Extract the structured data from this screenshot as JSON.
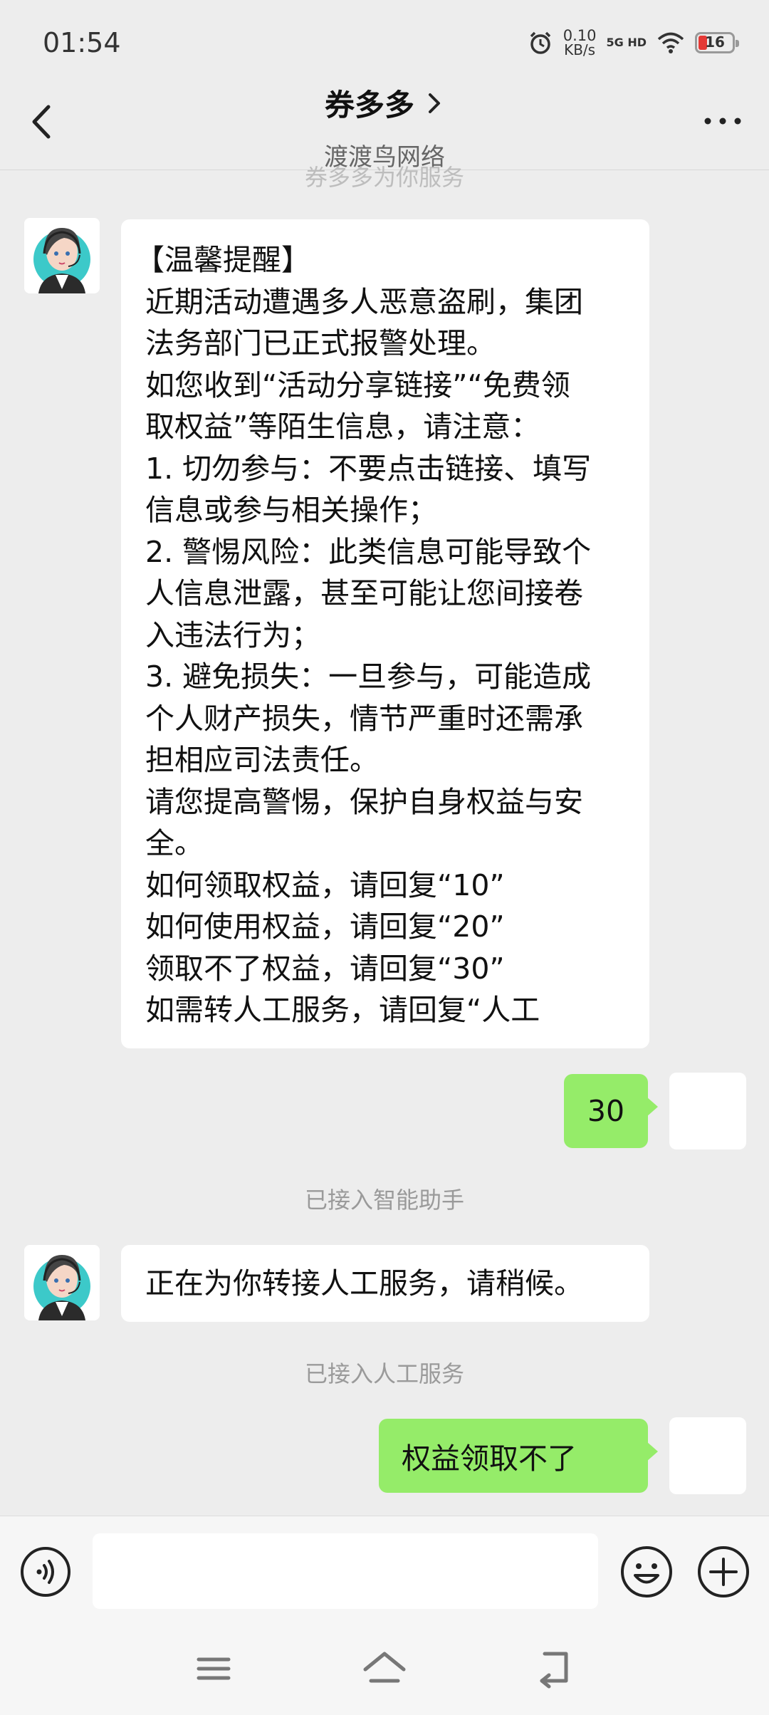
{
  "status": {
    "time": "01:54",
    "speed_value": "0.10",
    "speed_unit": "KB/s",
    "network": "5G HD",
    "battery": "16"
  },
  "header": {
    "title": "券多多",
    "subtitle": "渡渡鸟网络"
  },
  "chat": {
    "faded_notice": "券多多为你服务",
    "reminder_lines": [
      "【温馨提醒】",
      "近期活动遭遇多人恶意盗刷，集团",
      "法务部门已正式报警处理。",
      "如您收到“活动分享链接”“免费领",
      "取权益”等陌生信息，请注意：",
      "1. 切勿参与：不要点击链接、填写",
      "信息或参与相关操作；",
      "2. 警惕风险：此类信息可能导致个",
      "人信息泄露，甚至可能让您间接卷",
      "入违法行为；",
      "3. 避免损失：一旦参与，可能造成",
      "个人财产损失，情节严重时还需承",
      "担相应司法责任。",
      "请您提高警惕，保护自身权益与安",
      "全。",
      "如何领取权益，请回复“10”",
      "如何使用权益，请回复“20”",
      "领取不了权益，请回复“30”",
      "如需转人工服务，请回复“人工"
    ],
    "user_reply_1": "30",
    "system_notice_1": "已接入智能助手",
    "bot_reply": "正在为你转接人工服务，请稍候。",
    "system_notice_2": "已接入人工服务",
    "user_reply_2": "权益领取不了"
  },
  "input": {
    "placeholder": ""
  },
  "colors": {
    "background": "#ededed",
    "outgoing_bubble": "#95ec69",
    "incoming_bubble": "#ffffff"
  },
  "icons": [
    "back-icon",
    "chevron-right-icon",
    "more-icon",
    "voice-icon",
    "emoji-icon",
    "plus-icon",
    "menu-icon",
    "home-icon",
    "back-nav-icon"
  ]
}
